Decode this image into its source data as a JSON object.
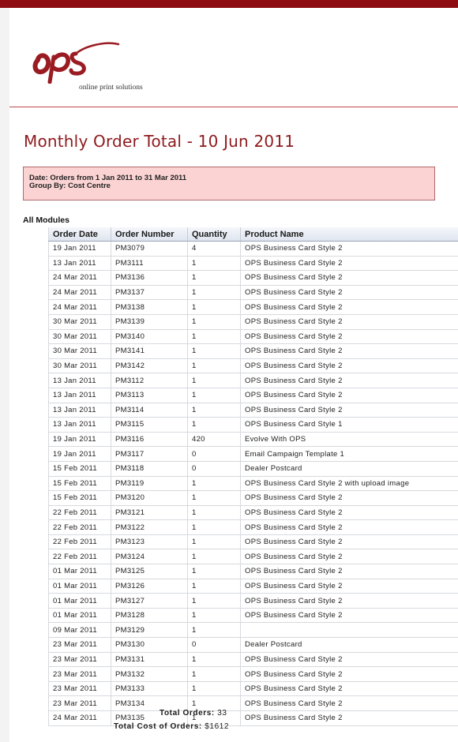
{
  "colors": {
    "brand": "#8e0d12",
    "title": "#8e1a1d",
    "criteria_bg": "#fbd3d3"
  },
  "logo": {
    "mark": "ops",
    "tagline": "online print solutions"
  },
  "page_title": "Monthly Order Total - 10 Jun 2011",
  "criteria": {
    "date_line": "Date: Orders from 1 Jan 2011 to 31 Mar 2011",
    "group_line": "Group By: Cost Centre"
  },
  "section_label": "All Modules",
  "table": {
    "headers": [
      "Order Date",
      "Order Number",
      "Quantity",
      "Product Name"
    ],
    "rows": [
      [
        "19 Jan 2011",
        "PM3079",
        "4",
        "OPS Business Card Style 2"
      ],
      [
        "13 Jan 2011",
        "PM3111",
        "1",
        "OPS Business Card Style 2"
      ],
      [
        "24 Mar 2011",
        "PM3136",
        "1",
        "OPS Business Card Style 2"
      ],
      [
        "24 Mar 2011",
        "PM3137",
        "1",
        "OPS Business Card Style 2"
      ],
      [
        "24 Mar 2011",
        "PM3138",
        "1",
        "OPS Business Card Style 2"
      ],
      [
        "30 Mar 2011",
        "PM3139",
        "1",
        "OPS Business Card Style 2"
      ],
      [
        "30 Mar 2011",
        "PM3140",
        "1",
        "OPS Business Card Style 2"
      ],
      [
        "30 Mar 2011",
        "PM3141",
        "1",
        "OPS Business Card Style 2"
      ],
      [
        "30 Mar 2011",
        "PM3142",
        "1",
        "OPS Business Card Style 2"
      ],
      [
        "13 Jan 2011",
        "PM3112",
        "1",
        "OPS Business Card Style 2"
      ],
      [
        "13 Jan 2011",
        "PM3113",
        "1",
        "OPS Business Card Style 2"
      ],
      [
        "13 Jan 2011",
        "PM3114",
        "1",
        "OPS Business Card Style 2"
      ],
      [
        "13 Jan 2011",
        "PM3115",
        "1",
        "OPS Business Card Style 1"
      ],
      [
        "19 Jan 2011",
        "PM3116",
        "420",
        "Evolve With OPS"
      ],
      [
        "19 Jan 2011",
        "PM3117",
        "0",
        "Email Campaign Template 1"
      ],
      [
        "15 Feb 2011",
        "PM3118",
        "0",
        "Dealer Postcard"
      ],
      [
        "15 Feb 2011",
        "PM3119",
        "1",
        "OPS Business Card Style 2 with upload image"
      ],
      [
        "15 Feb 2011",
        "PM3120",
        "1",
        "OPS Business Card Style 2"
      ],
      [
        "22 Feb 2011",
        "PM3121",
        "1",
        "OPS Business Card Style 2"
      ],
      [
        "22 Feb 2011",
        "PM3122",
        "1",
        "OPS Business Card Style 2"
      ],
      [
        "22 Feb 2011",
        "PM3123",
        "1",
        "OPS Business Card Style 2"
      ],
      [
        "22 Feb 2011",
        "PM3124",
        "1",
        "OPS Business Card Style 2"
      ],
      [
        "01 Mar 2011",
        "PM3125",
        "1",
        "OPS Business Card Style 2"
      ],
      [
        "01 Mar 2011",
        "PM3126",
        "1",
        "OPS Business Card Style 2"
      ],
      [
        "01 Mar 2011",
        "PM3127",
        "1",
        "OPS Business Card Style 2"
      ],
      [
        "01 Mar 2011",
        "PM3128",
        "1",
        "OPS Business Card Style 2"
      ],
      [
        "09 Mar 2011",
        "PM3129",
        "1",
        ""
      ],
      [
        "23 Mar 2011",
        "PM3130",
        "0",
        "Dealer Postcard"
      ],
      [
        "23 Mar 2011",
        "PM3131",
        "1",
        "OPS Business Card Style 2"
      ],
      [
        "23 Mar 2011",
        "PM3132",
        "1",
        "OPS Business Card Style 2"
      ],
      [
        "23 Mar 2011",
        "PM3133",
        "1",
        "OPS Business Card Style 2"
      ],
      [
        "23 Mar 2011",
        "PM3134",
        "1",
        "OPS Business Card Style 2"
      ],
      [
        "24 Mar 2011",
        "PM3135",
        "1",
        "OPS Business Card Style 2"
      ]
    ]
  },
  "totals": {
    "orders_label": "Total Orders:",
    "orders_value": "33",
    "cost_label": "Total Cost of Orders:",
    "cost_value": "$1612"
  }
}
